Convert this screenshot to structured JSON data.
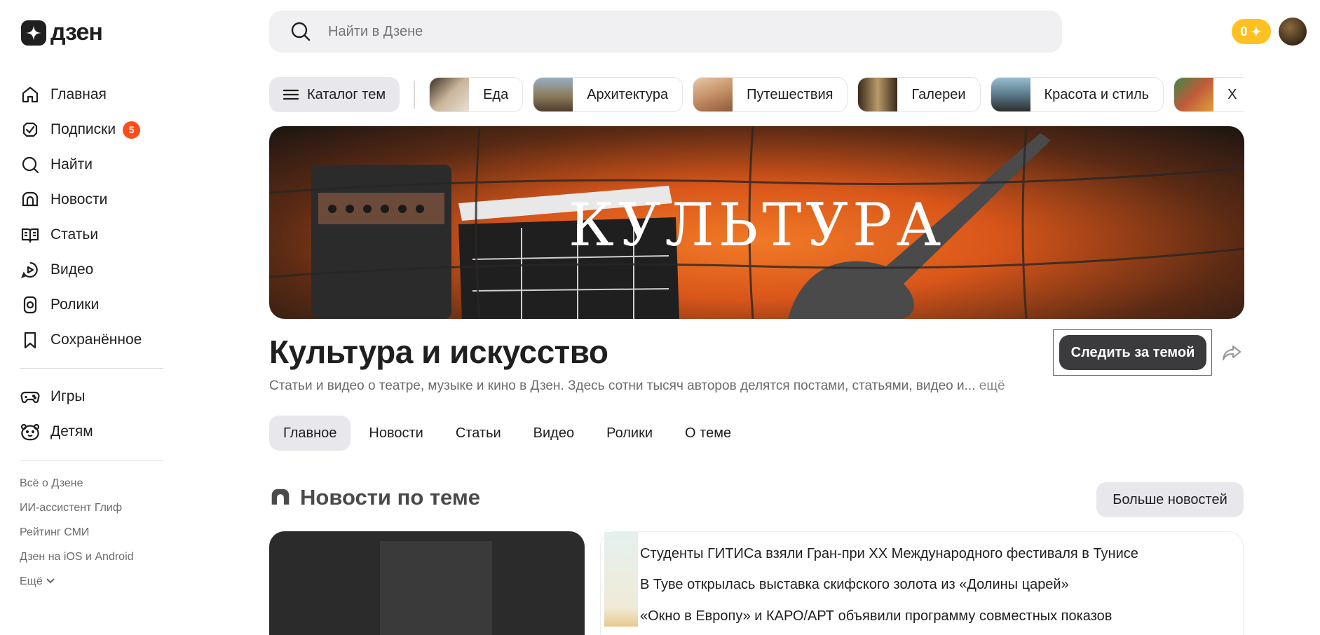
{
  "brand": {
    "name": "дзен"
  },
  "sidebar": {
    "items": [
      {
        "label": "Главная",
        "icon": "home-icon"
      },
      {
        "label": "Подписки",
        "icon": "subscriptions-icon",
        "badge": "5"
      },
      {
        "label": "Найти",
        "icon": "search-icon"
      },
      {
        "label": "Новости",
        "icon": "news-icon"
      },
      {
        "label": "Статьи",
        "icon": "articles-icon"
      },
      {
        "label": "Видео",
        "icon": "video-icon"
      },
      {
        "label": "Ролики",
        "icon": "shorts-icon"
      },
      {
        "label": "Сохранённое",
        "icon": "bookmark-icon"
      }
    ],
    "extra": [
      {
        "label": "Игры",
        "icon": "gamepad-icon"
      },
      {
        "label": "Детям",
        "icon": "kids-icon"
      }
    ],
    "footer": [
      "Всё о Дзене",
      "ИИ-ассистент Глиф",
      "Рейтинг СМИ",
      "Дзен на iOS и Android"
    ],
    "more_label": "Ещё"
  },
  "search": {
    "placeholder": "Найти в Дзене"
  },
  "header": {
    "coins": "0"
  },
  "topics": {
    "catalog_label": "Каталог тем",
    "chips": [
      {
        "label": "Еда",
        "color": "#c9b49a"
      },
      {
        "label": "Архитектура",
        "color": "#8a7a5a"
      },
      {
        "label": "Путешествия",
        "color": "#c08a60"
      },
      {
        "label": "Галереи",
        "color": "#7a5a3a"
      },
      {
        "label": "Красота и стиль",
        "color": "#5a7a8a"
      },
      {
        "label": "Х",
        "color": "#9a5a4a"
      }
    ]
  },
  "banner": {
    "title": "КУЛЬТУРА"
  },
  "page": {
    "title": "Культура и искусство",
    "description": "Статьи и видео о театре, музыке и кино в Дзен. Здесь сотни тысяч авторов делятся постами, статьями, видео и",
    "description_ellipsis": "...",
    "description_more": "ещё",
    "follow_label": "Следить за темой"
  },
  "tabs": [
    {
      "label": "Главное",
      "active": true
    },
    {
      "label": "Новости"
    },
    {
      "label": "Статьи"
    },
    {
      "label": "Видео"
    },
    {
      "label": "Ролики"
    },
    {
      "label": "О теме"
    }
  ],
  "news": {
    "title": "Новости по теме",
    "more_label": "Больше новостей",
    "items": [
      "Студенты ГИТИСа взяли Гран-при XX Международного фестиваля в Тунисе",
      "В Туве открылась выставка скифского золота из «Долины царей»",
      "«Окно в Европу» и КАРО/АРТ объявили программу совместных показов"
    ]
  },
  "colors": {
    "accent_badge": "#ff4d1a",
    "coins": "#ffc021",
    "follow_button": "#3b3b3e"
  }
}
